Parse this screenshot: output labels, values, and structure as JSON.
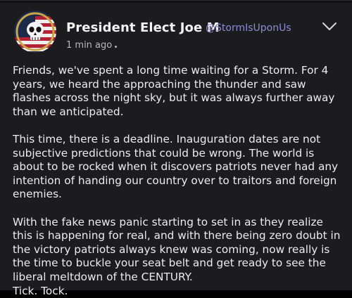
{
  "post": {
    "author_name": "President Elect Joe M",
    "author_handle": "@StormIsUponUs",
    "timestamp": "1 min ago",
    "paragraphs": [
      "Friends, we've spent a long time waiting for a Storm. For 4 years, we heard the approaching the thunder and saw flashes across the night sky, but it was always further away than we anticipated.",
      "This time, there is a deadline. Inauguration dates are not subjective predictions that could be wrong. The world is about to be rocked when it discovers patriots never had any intention of handing our country over to traitors and foreign enemies.",
      "With the fake news panic starting to set in as they realize this is happening for real, and with there being zero doubt in the victory patriots always knew was coming, now really is the time to buckle your seat belt and get ready to see the liberal meltdown of the CENTURY."
    ],
    "closing_line": "Tick. Tock."
  },
  "icons": {
    "avatar": "skull-flag-avatar",
    "menu": "chevron-down-icon"
  },
  "colors": {
    "background": "#1c1c1e",
    "text": "#ececec",
    "handle": "#8b8bd6",
    "muted": "#b9b9bd"
  }
}
